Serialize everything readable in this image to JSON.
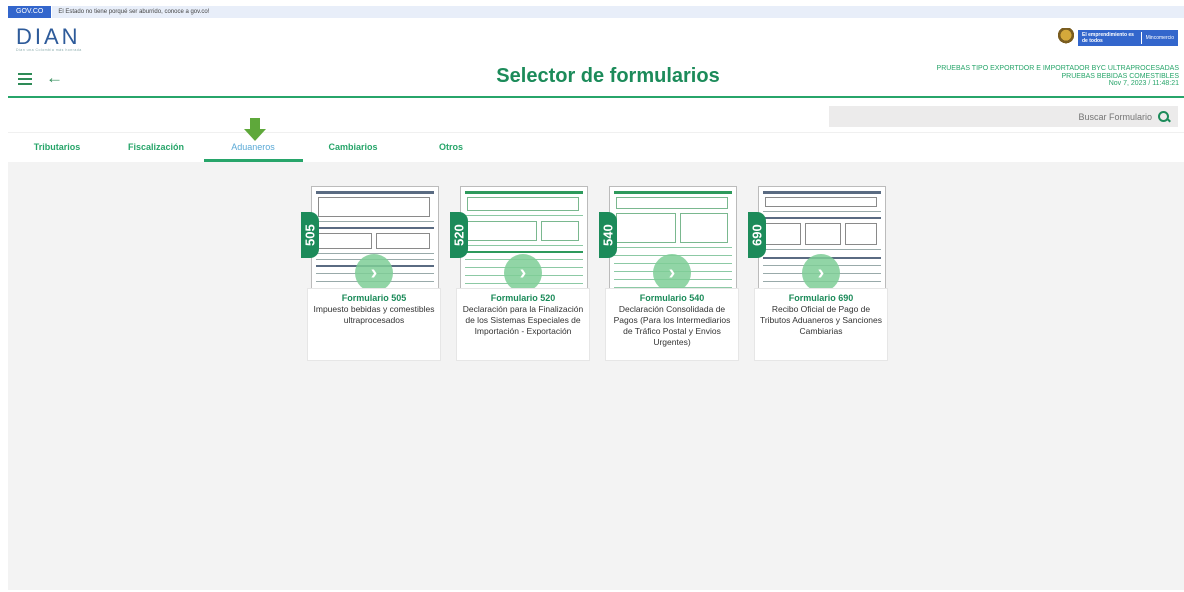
{
  "govbar": {
    "logo": "GOV.CO",
    "message": "El Estado no tiene porqué ser aburrido, conoce a gov.co!"
  },
  "brand": {
    "name": "DIAN",
    "tagline": "Dian una Colombia más honrada"
  },
  "partner_badge": {
    "text_a": "El emprendimiento es de todos",
    "text_b": "Mincomercio"
  },
  "toolbar": {
    "title": "Selector de formularios",
    "meta_line1": "PRUEBAS TIPO EXPORTDOR E IMPORTADOR BYC ULTRAPROCESADAS",
    "meta_line2": "PRUEBAS BEBIDAS COMESTIBLES",
    "meta_line3": "Nov 7, 2023 / 11:48:21"
  },
  "search": {
    "placeholder": "Buscar Formulario"
  },
  "tabs": [
    {
      "label": "Tributarios"
    },
    {
      "label": "Fiscalización"
    },
    {
      "label": "Aduaneros"
    },
    {
      "label": "Cambiarios"
    },
    {
      "label": "Otros"
    }
  ],
  "cards": [
    {
      "number": "505",
      "title": "Formulario 505",
      "desc": "Impuesto bebidas y comestibles ultraprocesados",
      "style": "gray"
    },
    {
      "number": "520",
      "title": "Formulario 520",
      "desc": "Declaración para la Finalización de los Sistemas Especiales de Importación - Exportación",
      "style": "green"
    },
    {
      "number": "540",
      "title": "Formulario 540",
      "desc": "Declaración Consolidada de Pagos (Para los Intermediarios de Tráfico Postal y Envios Urgentes)",
      "style": "green"
    },
    {
      "number": "690",
      "title": "Formulario 690",
      "desc": "Recibo Oficial de Pago de Tributos Aduaneros y Sanciones Cambiarias",
      "style": "gray"
    }
  ],
  "colors": {
    "accent": "#1c8b5a",
    "govbar": "#3366cc",
    "arrow": "#5ea83a"
  }
}
